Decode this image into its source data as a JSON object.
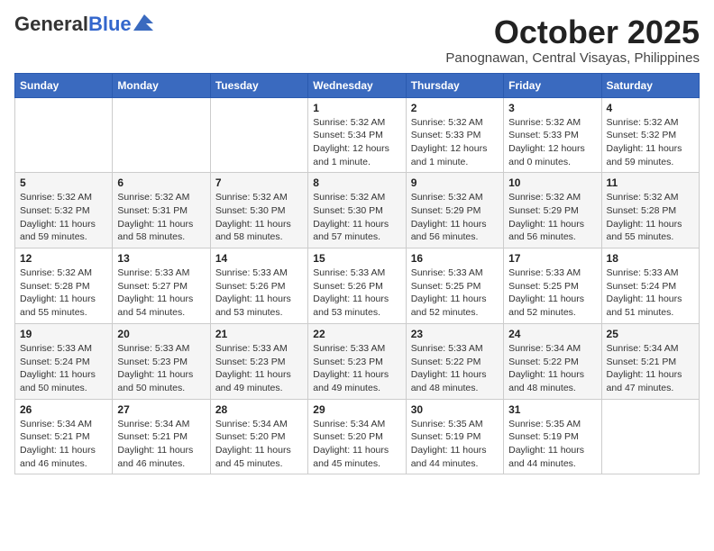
{
  "header": {
    "logo_general": "General",
    "logo_blue": "Blue",
    "month": "October 2025",
    "location": "Panognawan, Central Visayas, Philippines"
  },
  "weekdays": [
    "Sunday",
    "Monday",
    "Tuesday",
    "Wednesday",
    "Thursday",
    "Friday",
    "Saturday"
  ],
  "weeks": [
    [
      {
        "day": "",
        "sunrise": "",
        "sunset": "",
        "daylight": ""
      },
      {
        "day": "",
        "sunrise": "",
        "sunset": "",
        "daylight": ""
      },
      {
        "day": "",
        "sunrise": "",
        "sunset": "",
        "daylight": ""
      },
      {
        "day": "1",
        "sunrise": "Sunrise: 5:32 AM",
        "sunset": "Sunset: 5:34 PM",
        "daylight": "Daylight: 12 hours and 1 minute."
      },
      {
        "day": "2",
        "sunrise": "Sunrise: 5:32 AM",
        "sunset": "Sunset: 5:33 PM",
        "daylight": "Daylight: 12 hours and 1 minute."
      },
      {
        "day": "3",
        "sunrise": "Sunrise: 5:32 AM",
        "sunset": "Sunset: 5:33 PM",
        "daylight": "Daylight: 12 hours and 0 minutes."
      },
      {
        "day": "4",
        "sunrise": "Sunrise: 5:32 AM",
        "sunset": "Sunset: 5:32 PM",
        "daylight": "Daylight: 11 hours and 59 minutes."
      }
    ],
    [
      {
        "day": "5",
        "sunrise": "Sunrise: 5:32 AM",
        "sunset": "Sunset: 5:32 PM",
        "daylight": "Daylight: 11 hours and 59 minutes."
      },
      {
        "day": "6",
        "sunrise": "Sunrise: 5:32 AM",
        "sunset": "Sunset: 5:31 PM",
        "daylight": "Daylight: 11 hours and 58 minutes."
      },
      {
        "day": "7",
        "sunrise": "Sunrise: 5:32 AM",
        "sunset": "Sunset: 5:30 PM",
        "daylight": "Daylight: 11 hours and 58 minutes."
      },
      {
        "day": "8",
        "sunrise": "Sunrise: 5:32 AM",
        "sunset": "Sunset: 5:30 PM",
        "daylight": "Daylight: 11 hours and 57 minutes."
      },
      {
        "day": "9",
        "sunrise": "Sunrise: 5:32 AM",
        "sunset": "Sunset: 5:29 PM",
        "daylight": "Daylight: 11 hours and 56 minutes."
      },
      {
        "day": "10",
        "sunrise": "Sunrise: 5:32 AM",
        "sunset": "Sunset: 5:29 PM",
        "daylight": "Daylight: 11 hours and 56 minutes."
      },
      {
        "day": "11",
        "sunrise": "Sunrise: 5:32 AM",
        "sunset": "Sunset: 5:28 PM",
        "daylight": "Daylight: 11 hours and 55 minutes."
      }
    ],
    [
      {
        "day": "12",
        "sunrise": "Sunrise: 5:32 AM",
        "sunset": "Sunset: 5:28 PM",
        "daylight": "Daylight: 11 hours and 55 minutes."
      },
      {
        "day": "13",
        "sunrise": "Sunrise: 5:33 AM",
        "sunset": "Sunset: 5:27 PM",
        "daylight": "Daylight: 11 hours and 54 minutes."
      },
      {
        "day": "14",
        "sunrise": "Sunrise: 5:33 AM",
        "sunset": "Sunset: 5:26 PM",
        "daylight": "Daylight: 11 hours and 53 minutes."
      },
      {
        "day": "15",
        "sunrise": "Sunrise: 5:33 AM",
        "sunset": "Sunset: 5:26 PM",
        "daylight": "Daylight: 11 hours and 53 minutes."
      },
      {
        "day": "16",
        "sunrise": "Sunrise: 5:33 AM",
        "sunset": "Sunset: 5:25 PM",
        "daylight": "Daylight: 11 hours and 52 minutes."
      },
      {
        "day": "17",
        "sunrise": "Sunrise: 5:33 AM",
        "sunset": "Sunset: 5:25 PM",
        "daylight": "Daylight: 11 hours and 52 minutes."
      },
      {
        "day": "18",
        "sunrise": "Sunrise: 5:33 AM",
        "sunset": "Sunset: 5:24 PM",
        "daylight": "Daylight: 11 hours and 51 minutes."
      }
    ],
    [
      {
        "day": "19",
        "sunrise": "Sunrise: 5:33 AM",
        "sunset": "Sunset: 5:24 PM",
        "daylight": "Daylight: 11 hours and 50 minutes."
      },
      {
        "day": "20",
        "sunrise": "Sunrise: 5:33 AM",
        "sunset": "Sunset: 5:23 PM",
        "daylight": "Daylight: 11 hours and 50 minutes."
      },
      {
        "day": "21",
        "sunrise": "Sunrise: 5:33 AM",
        "sunset": "Sunset: 5:23 PM",
        "daylight": "Daylight: 11 hours and 49 minutes."
      },
      {
        "day": "22",
        "sunrise": "Sunrise: 5:33 AM",
        "sunset": "Sunset: 5:23 PM",
        "daylight": "Daylight: 11 hours and 49 minutes."
      },
      {
        "day": "23",
        "sunrise": "Sunrise: 5:33 AM",
        "sunset": "Sunset: 5:22 PM",
        "daylight": "Daylight: 11 hours and 48 minutes."
      },
      {
        "day": "24",
        "sunrise": "Sunrise: 5:34 AM",
        "sunset": "Sunset: 5:22 PM",
        "daylight": "Daylight: 11 hours and 48 minutes."
      },
      {
        "day": "25",
        "sunrise": "Sunrise: 5:34 AM",
        "sunset": "Sunset: 5:21 PM",
        "daylight": "Daylight: 11 hours and 47 minutes."
      }
    ],
    [
      {
        "day": "26",
        "sunrise": "Sunrise: 5:34 AM",
        "sunset": "Sunset: 5:21 PM",
        "daylight": "Daylight: 11 hours and 46 minutes."
      },
      {
        "day": "27",
        "sunrise": "Sunrise: 5:34 AM",
        "sunset": "Sunset: 5:21 PM",
        "daylight": "Daylight: 11 hours and 46 minutes."
      },
      {
        "day": "28",
        "sunrise": "Sunrise: 5:34 AM",
        "sunset": "Sunset: 5:20 PM",
        "daylight": "Daylight: 11 hours and 45 minutes."
      },
      {
        "day": "29",
        "sunrise": "Sunrise: 5:34 AM",
        "sunset": "Sunset: 5:20 PM",
        "daylight": "Daylight: 11 hours and 45 minutes."
      },
      {
        "day": "30",
        "sunrise": "Sunrise: 5:35 AM",
        "sunset": "Sunset: 5:19 PM",
        "daylight": "Daylight: 11 hours and 44 minutes."
      },
      {
        "day": "31",
        "sunrise": "Sunrise: 5:35 AM",
        "sunset": "Sunset: 5:19 PM",
        "daylight": "Daylight: 11 hours and 44 minutes."
      },
      {
        "day": "",
        "sunrise": "",
        "sunset": "",
        "daylight": ""
      }
    ]
  ]
}
